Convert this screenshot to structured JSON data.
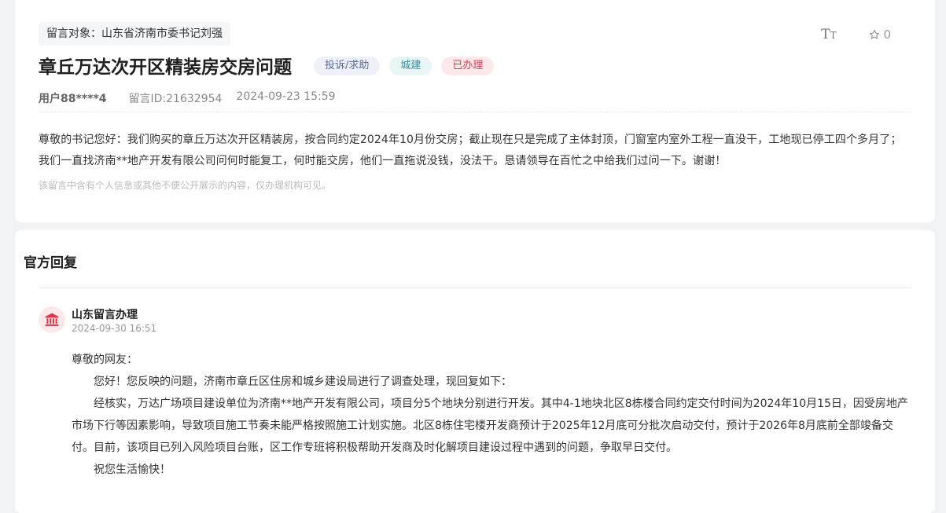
{
  "petition": {
    "target_label": "留言对象：山东省济南市委书记刘强",
    "title": "章丘万达次开区精装房交房问题",
    "tags": {
      "type": "投诉/求助",
      "domain": "城建",
      "status": "已办理"
    },
    "user": "用户88****4",
    "message_id": "留言ID:21632954",
    "time": "2024-09-23 15:59",
    "content": "尊敬的书记您好：我们购买的章丘万达次开区精装房，按合同约定2024年10月份交房；截止现在只是完成了主体封顶，门窗室内室外工程一直没干，工地现已停工四个多月了；我们一直找济南**地产开发有限公司问何时能复工，何时能交房，他们一直拖说没钱，没法干。恳请领导在百忙之中给我们过问一下。谢谢！",
    "privacy_note": "该留言中含有个人信息或其他不便公开展示的内容，仅办理机构可见。",
    "like_count": "0"
  },
  "icons": {
    "font_size": "font-size-icon",
    "star": "star-icon",
    "institution": "institution-icon"
  },
  "reply": {
    "section_title": "官方回复",
    "org_name": "山东留言办理",
    "time": "2024-09-30 16:51",
    "paragraphs": [
      "尊敬的网友：",
      "您好！您反映的问题，济南市章丘区住房和城乡建设局进行了调查处理，现回复如下：",
      "经核实，万达广场项目建设单位为济南**地产开发有限公司，项目分5个地块分别进行开发。其中4-1地块北区8栋楼合同约定交付时间为2024年10月15日，因受房地产市场下行等因素影响，导致项目施工节奏未能严格按照施工计划实施。北区8栋住宅楼开发商预计于2025年12月底可分批次启动交付，预计于2026年8月底前全部竣备交付。目前，该项目已列入风险项目台账，区工作专班将积极帮助开发商及时化解项目建设过程中遇到的问题，争取早日交付。",
      "祝您生活愉快！"
    ]
  },
  "colors": {
    "status_red": "#e0364d",
    "domain_teal": "#3b8b99",
    "type_blue": "#5a6c93",
    "avatar_icon": "#e0364d"
  }
}
